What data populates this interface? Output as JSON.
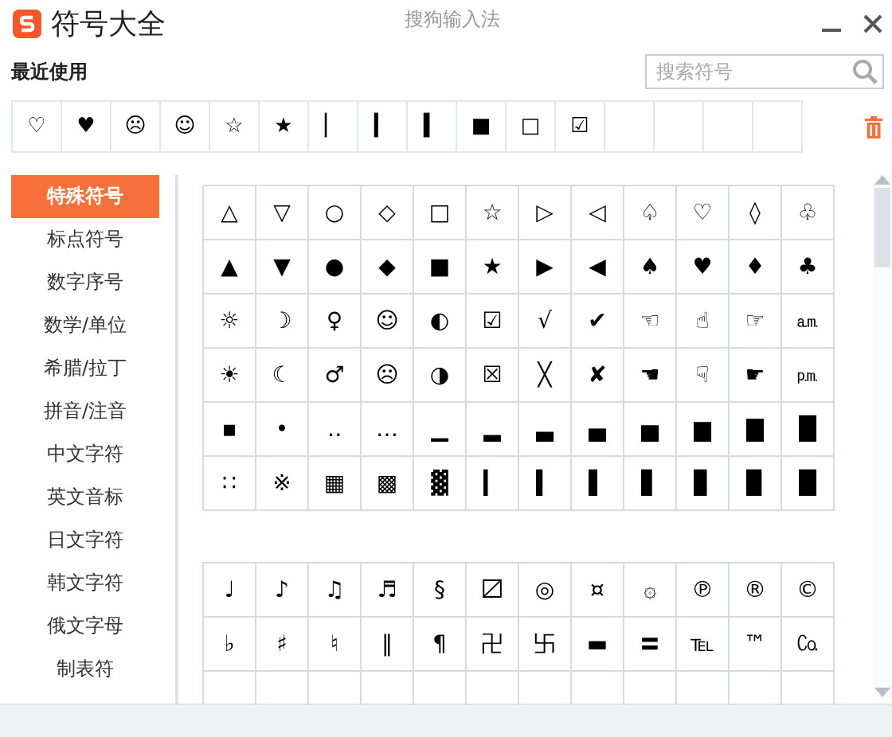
{
  "window": {
    "title": "符号大全",
    "app_name": "搜狗输入法"
  },
  "recent": {
    "label": "最近使用",
    "symbols": [
      "♡",
      "♥",
      "☹",
      "☺",
      "☆",
      "★",
      "▏",
      "▎",
      "▍",
      "■",
      "□",
      "☑"
    ]
  },
  "search": {
    "placeholder": "搜索符号"
  },
  "sidebar": {
    "items": [
      {
        "label": "特殊符号",
        "selected": true
      },
      {
        "label": "标点符号",
        "selected": false
      },
      {
        "label": "数字序号",
        "selected": false
      },
      {
        "label": "数学/单位",
        "selected": false
      },
      {
        "label": "希腊/拉丁",
        "selected": false
      },
      {
        "label": "拼音/注音",
        "selected": false
      },
      {
        "label": "中文字符",
        "selected": false
      },
      {
        "label": "英文音标",
        "selected": false
      },
      {
        "label": "日文字符",
        "selected": false
      },
      {
        "label": "韩文字符",
        "selected": false
      },
      {
        "label": "俄文字母",
        "selected": false
      },
      {
        "label": "制表符",
        "selected": false
      }
    ]
  },
  "sections": [
    {
      "symbols": [
        "△",
        "▽",
        "○",
        "◇",
        "□",
        "☆",
        "▷",
        "◁",
        "♤",
        "♡",
        "◊",
        "♧",
        "▲",
        "▼",
        "●",
        "◆",
        "■",
        "★",
        "▶",
        "◀",
        "♠",
        "♥",
        "♦",
        "♣",
        "☼",
        "☽",
        "♀",
        "☺",
        "◐",
        "☑",
        "√",
        "✔",
        "☜",
        "☝",
        "☞",
        "㏂",
        "☀",
        "☾",
        "♂",
        "☹",
        "◑",
        "☒",
        "╳",
        "✘",
        "☚",
        "☟",
        "☛",
        "㏘",
        "▪",
        "•",
        "‥",
        "…",
        "▁",
        "▂",
        "▃",
        "▄",
        "▅",
        "▆",
        "▇",
        "█",
        "∷",
        "※",
        "▦",
        "▩",
        "▓",
        "▎",
        "▍",
        "▌",
        "▋",
        "▊",
        "▉",
        "█"
      ]
    },
    {
      "symbols": [
        "♩",
        "♪",
        "♫",
        "♬",
        "§",
        "〼",
        "◎",
        "¤",
        "۞",
        "℗",
        "®",
        "©",
        "♭",
        "♯",
        "♮",
        "‖",
        "¶",
        "卍",
        "卐",
        "▬",
        "〓",
        "℡",
        "™",
        "㏇"
      ]
    }
  ]
}
